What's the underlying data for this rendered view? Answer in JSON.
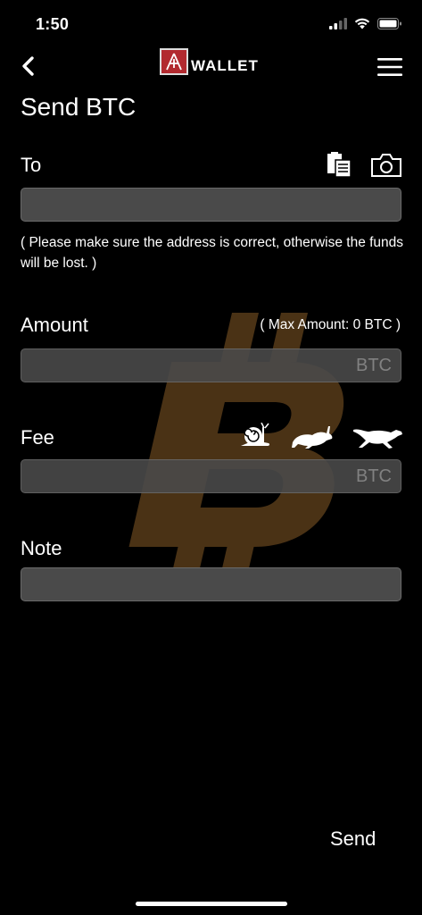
{
  "status_bar": {
    "time": "1:50"
  },
  "nav": {
    "logo_text": "WALLET"
  },
  "page": {
    "title": "Send BTC"
  },
  "to": {
    "label": "To",
    "value": "",
    "hint": "( Please make sure the address is correct, otherwise the funds will be lost. )"
  },
  "amount": {
    "label": "Amount",
    "max_note": "( Max Amount: 0 BTC )",
    "value": "",
    "unit": "BTC"
  },
  "fee": {
    "label": "Fee",
    "value": "",
    "unit": "BTC"
  },
  "note": {
    "label": "Note",
    "value": ""
  },
  "actions": {
    "send_label": "Send"
  },
  "colors": {
    "background": "#000000",
    "input_bg": "#4a4a4a",
    "bitcoin_watermark": "#4a3215",
    "logo_red": "#b22a2f"
  },
  "icons": [
    "back-chevron-icon",
    "menu-icon",
    "clipboard-icon",
    "camera-icon",
    "snail-icon",
    "rabbit-icon",
    "cheetah-icon",
    "bitcoin-icon",
    "wifi-icon",
    "battery-icon",
    "signal-icon"
  ]
}
